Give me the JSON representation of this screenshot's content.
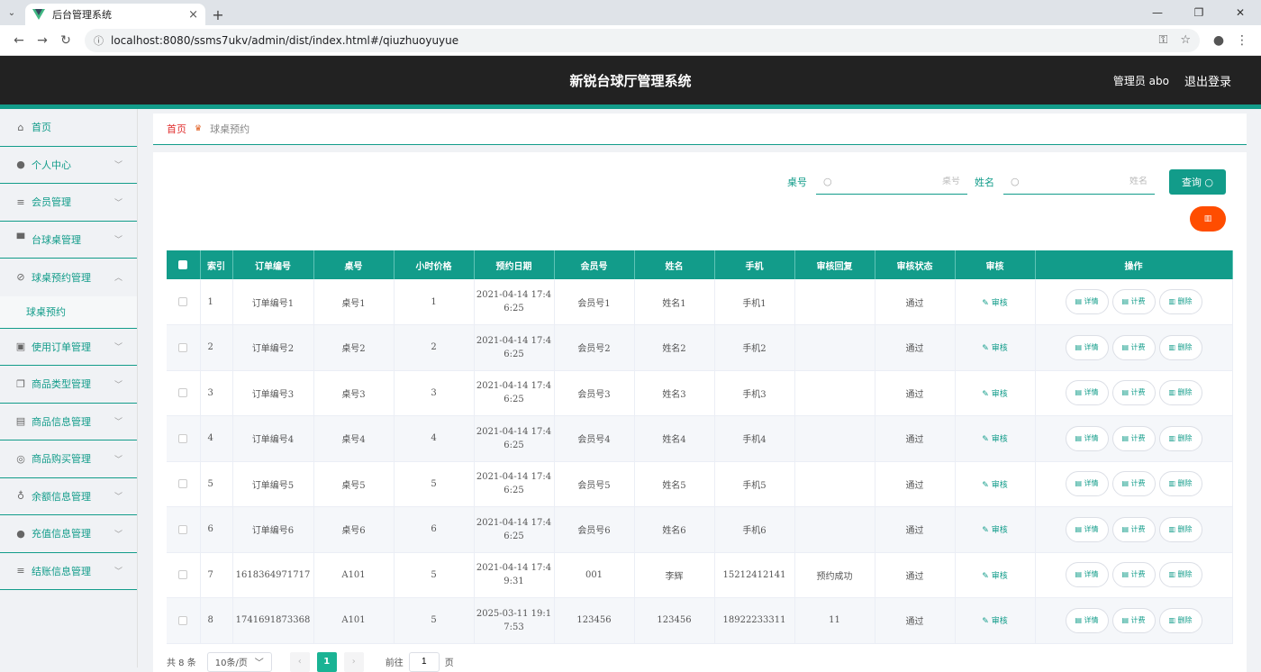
{
  "browser": {
    "tab_title": "后台管理系统",
    "url": "localhost:8080/ssms7ukv/admin/dist/index.html#/qiuzhuoyuyue"
  },
  "header": {
    "title": "新锐台球厅管理系统",
    "user": "管理员 abo",
    "logout": "退出登录"
  },
  "sidebar": {
    "items": [
      {
        "label": "首页",
        "icon": "home-icon"
      },
      {
        "label": "个人中心",
        "icon": "user-icon"
      },
      {
        "label": "会员管理",
        "icon": "list-icon"
      },
      {
        "label": "台球桌管理",
        "icon": "table-icon"
      },
      {
        "label": "球桌预约管理",
        "icon": "calendar-icon"
      },
      {
        "label": "使用订单管理",
        "icon": "chart-icon"
      },
      {
        "label": "商品类型管理",
        "icon": "copy-icon"
      },
      {
        "label": "商品信息管理",
        "icon": "clipboard-icon"
      },
      {
        "label": "商品购买管理",
        "icon": "cart-icon"
      },
      {
        "label": "余额信息管理",
        "icon": "mic-icon"
      },
      {
        "label": "充值信息管理",
        "icon": "user-icon"
      },
      {
        "label": "结账信息管理",
        "icon": "list-icon"
      }
    ],
    "sub_item": "球桌预约"
  },
  "breadcrumb": {
    "home": "首页",
    "current": "球桌预约"
  },
  "search": {
    "table_label": "桌号",
    "table_placeholder": "桌号",
    "name_label": "姓名",
    "name_placeholder": "姓名",
    "query_button": "查询"
  },
  "table": {
    "headers": [
      "索引",
      "订单编号",
      "桌号",
      "小时价格",
      "预约日期",
      "会员号",
      "姓名",
      "手机",
      "审核回复",
      "审核状态",
      "审核",
      "操作"
    ],
    "audit_label": "审核",
    "op_detail": "详情",
    "op_bill": "计费",
    "op_delete": "删除",
    "rows": [
      {
        "idx": "1",
        "order": "订单编号1",
        "desk": "桌号1",
        "price": "1",
        "date1": "2021-04-14 17:4",
        "date2": "6:25",
        "member": "会员号1",
        "name": "姓名1",
        "phone": "手机1",
        "reply": "",
        "status": "通过"
      },
      {
        "idx": "2",
        "order": "订单编号2",
        "desk": "桌号2",
        "price": "2",
        "date1": "2021-04-14 17:4",
        "date2": "6:25",
        "member": "会员号2",
        "name": "姓名2",
        "phone": "手机2",
        "reply": "",
        "status": "通过"
      },
      {
        "idx": "3",
        "order": "订单编号3",
        "desk": "桌号3",
        "price": "3",
        "date1": "2021-04-14 17:4",
        "date2": "6:25",
        "member": "会员号3",
        "name": "姓名3",
        "phone": "手机3",
        "reply": "",
        "status": "通过"
      },
      {
        "idx": "4",
        "order": "订单编号4",
        "desk": "桌号4",
        "price": "4",
        "date1": "2021-04-14 17:4",
        "date2": "6:25",
        "member": "会员号4",
        "name": "姓名4",
        "phone": "手机4",
        "reply": "",
        "status": "通过"
      },
      {
        "idx": "5",
        "order": "订单编号5",
        "desk": "桌号5",
        "price": "5",
        "date1": "2021-04-14 17:4",
        "date2": "6:25",
        "member": "会员号5",
        "name": "姓名5",
        "phone": "手机5",
        "reply": "",
        "status": "通过"
      },
      {
        "idx": "6",
        "order": "订单编号6",
        "desk": "桌号6",
        "price": "6",
        "date1": "2021-04-14 17:4",
        "date2": "6:25",
        "member": "会员号6",
        "name": "姓名6",
        "phone": "手机6",
        "reply": "",
        "status": "通过"
      },
      {
        "idx": "7",
        "order": "1618364971717",
        "desk": "A101",
        "price": "5",
        "date1": "2021-04-14 17:4",
        "date2": "9:31",
        "member": "001",
        "name": "李辉",
        "phone": "15212412141",
        "reply": "预约成功",
        "status": "通过"
      },
      {
        "idx": "8",
        "order": "1741691873368",
        "desk": "A101",
        "price": "5",
        "date1": "2025-03-11 19:1",
        "date2": "7:53",
        "member": "123456",
        "name": "123456",
        "phone": "18922233311",
        "reply": "11",
        "status": "通过"
      }
    ]
  },
  "pager": {
    "total": "共 8 条",
    "page_size": "10条/页",
    "current_page": "1",
    "goto_prefix": "前往",
    "goto_value": "1",
    "goto_suffix": "页"
  },
  "colors": {
    "accent": "#129c8a",
    "header_bg": "#222222",
    "danger": "#ff4d00"
  }
}
